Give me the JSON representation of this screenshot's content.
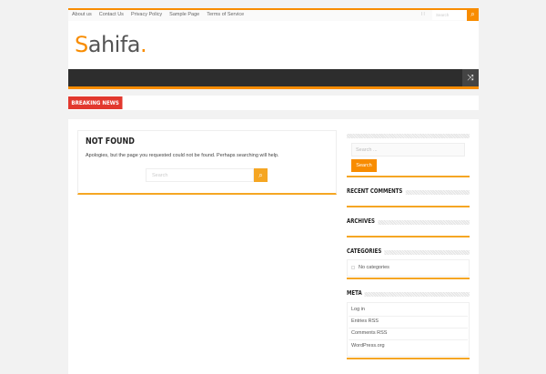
{
  "topbar": {
    "links": [
      "About us",
      "Contact Us",
      "Privacy Policy",
      "Sample Page",
      "Terms of Service"
    ],
    "search_placeholder": "Search"
  },
  "logo": {
    "s": "S",
    "rest": "ahifa",
    "dot": "."
  },
  "breaking_news": "BREAKING NEWS",
  "main": {
    "title": "NOT FOUND",
    "message": "Apologies, but the page you requested could not be found. Perhaps searching will help.",
    "search_placeholder": "Search"
  },
  "sidebar": {
    "search_placeholder": "Search ...",
    "search_button": "Search",
    "recent_comments": "RECENT COMMENTS",
    "archives": "ARCHIVES",
    "categories": "CATEGORIES",
    "no_categories": "No categories",
    "meta": "META",
    "meta_items": [
      "Log in",
      "Entries RSS",
      "Comments RSS",
      "WordPress.org"
    ]
  },
  "colors": {
    "accent": "#f88c00",
    "breaking": "#e2382e",
    "nav": "#2d2d2d"
  }
}
